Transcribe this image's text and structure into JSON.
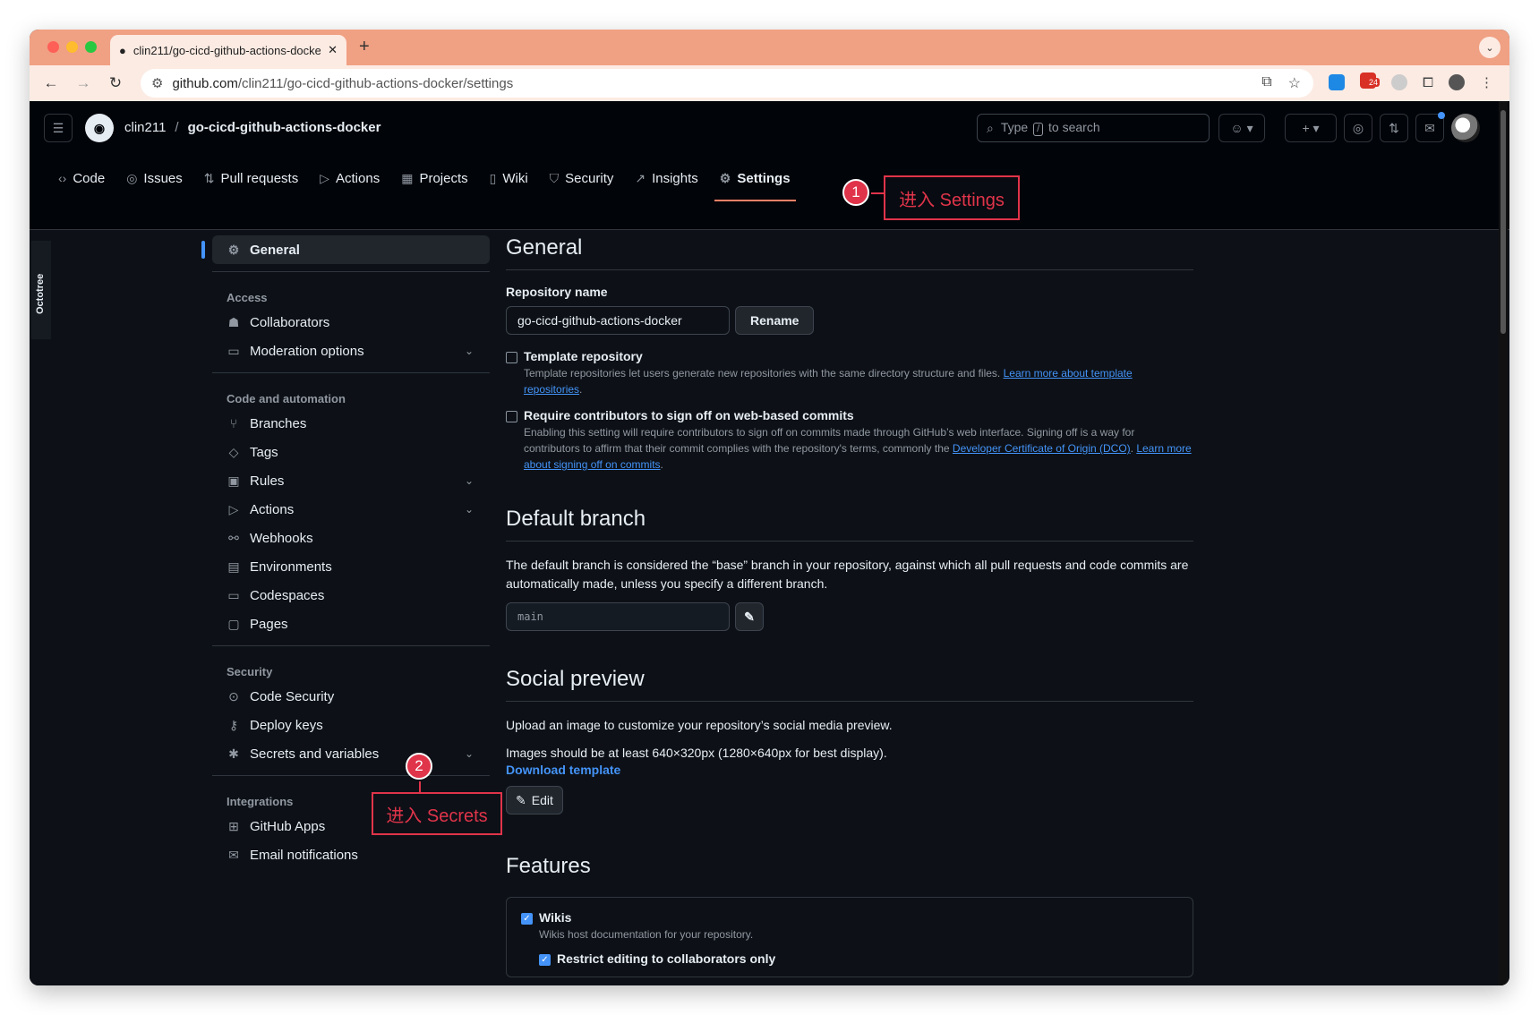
{
  "browser": {
    "tab_title": "clin211/go-cicd-github-actions-docker",
    "url_host": "github.com",
    "url_path": "/clin211/go-cicd-github-actions-docker/settings",
    "ext_badge": "24"
  },
  "header": {
    "owner": "clin211",
    "separator": "/",
    "repo": "go-cicd-github-actions-docker",
    "search_prefix": "Type",
    "search_key": "/",
    "search_suffix": "to search"
  },
  "repo_nav": [
    {
      "label": "Code",
      "icon": "code-icon"
    },
    {
      "label": "Issues",
      "icon": "issue-icon"
    },
    {
      "label": "Pull requests",
      "icon": "pull-request-icon"
    },
    {
      "label": "Actions",
      "icon": "play-icon"
    },
    {
      "label": "Projects",
      "icon": "table-icon"
    },
    {
      "label": "Wiki",
      "icon": "book-icon"
    },
    {
      "label": "Security",
      "icon": "shield-icon"
    },
    {
      "label": "Insights",
      "icon": "graph-icon"
    },
    {
      "label": "Settings",
      "icon": "gear-icon",
      "selected": true
    }
  ],
  "octotree": "Octotree",
  "sidebar": {
    "general": "General",
    "access_heading": "Access",
    "collaborators": "Collaborators",
    "moderation": "Moderation options",
    "code_heading": "Code and automation",
    "branches": "Branches",
    "tags": "Tags",
    "rules": "Rules",
    "actions": "Actions",
    "webhooks": "Webhooks",
    "environments": "Environments",
    "codespaces": "Codespaces",
    "pages": "Pages",
    "security_heading": "Security",
    "code_security": "Code Security",
    "deploy_keys": "Deploy keys",
    "secrets": "Secrets and variables",
    "integrations_heading": "Integrations",
    "github_apps": "GitHub Apps",
    "email_notifications": "Email notifications"
  },
  "main": {
    "general_title": "General",
    "repo_name_label": "Repository name",
    "repo_name_value": "go-cicd-github-actions-docker",
    "rename_button": "Rename",
    "template_title": "Template repository",
    "template_desc": "Template repositories let users generate new repositories with the same directory structure and files.",
    "template_link": "Learn more about template repositories",
    "signoff_title": "Require contributors to sign off on web-based commits",
    "signoff_desc": "Enabling this setting will require contributors to sign off on commits made through GitHub’s web interface. Signing off is a way for contributors to affirm that their commit complies with the repository's terms, commonly the",
    "signoff_link": "Developer Certificate of Origin (DCO)",
    "signoff_link2": "Learn more about signing off on commits",
    "default_branch_title": "Default branch",
    "default_branch_desc": "The default branch is considered the “base” branch in your repository, against which all pull requests and code commits are automatically made, unless you specify a different branch.",
    "default_branch_value": "main",
    "social_title": "Social preview",
    "social_desc1": "Upload an image to customize your repository’s social media preview.",
    "social_desc2": "Images should be at least 640×320px (1280×640px for best display).",
    "download_template": "Download template",
    "edit_button": "Edit",
    "features_title": "Features",
    "wikis_title": "Wikis",
    "wikis_desc": "Wikis host documentation for your repository.",
    "restrict_title": "Restrict editing to collaborators only"
  },
  "annotations": {
    "badge1": "1",
    "callout1": "进入 Settings",
    "badge2": "2",
    "callout2": "进入 Secrets"
  },
  "colors": {
    "accent": "#4493f8",
    "annotation": "#e0344a",
    "tab_underline": "#f78166"
  }
}
